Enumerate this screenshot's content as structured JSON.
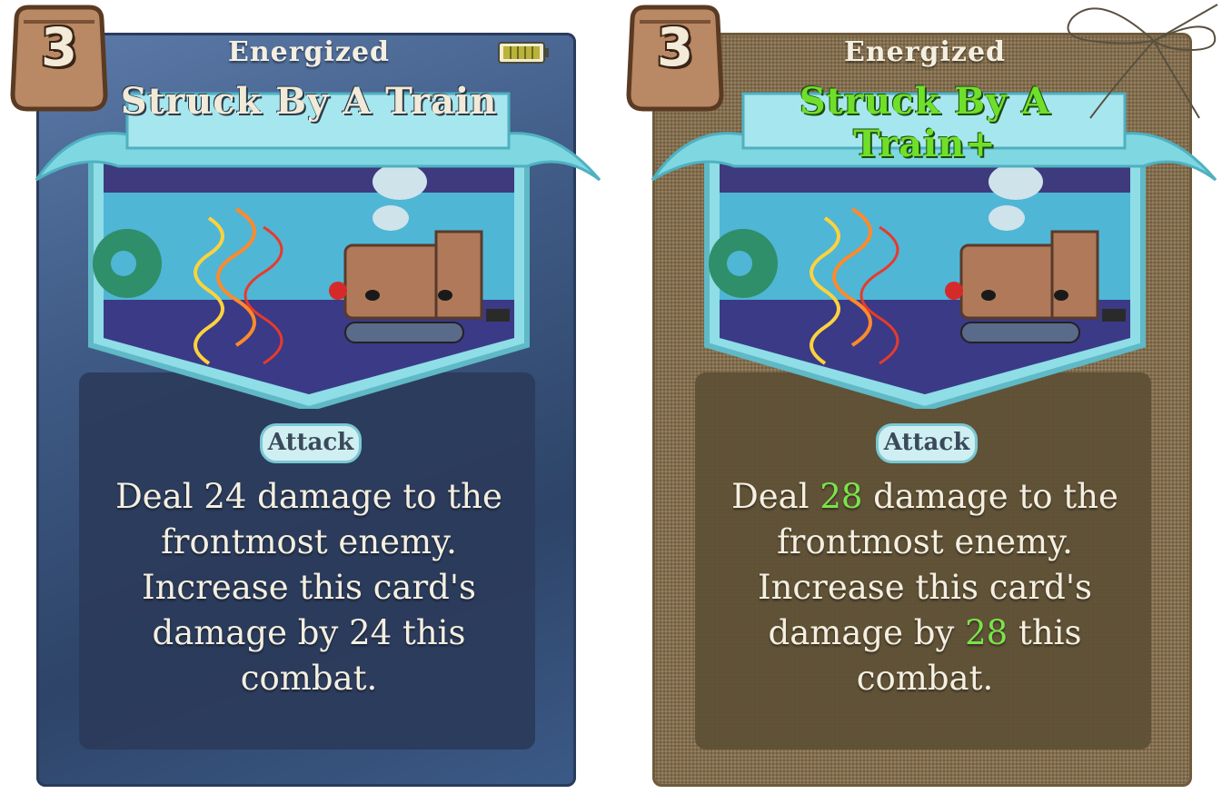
{
  "cards": [
    {
      "cost": "3",
      "keyword": "Energized",
      "title": "Struck By A Train",
      "type": "Attack",
      "description": {
        "line1_pre": "Deal ",
        "line1_value": "24",
        "line1_post": " damage to the",
        "line2": "frontmost enemy.",
        "line3": "Increase this card's",
        "line4_pre": "damage by ",
        "line4_value": "24",
        "line4_post": " this",
        "line5": "combat."
      },
      "charge_fraction": 1.0,
      "upgraded": false,
      "background": "blue",
      "title_color": "#f1ead8"
    },
    {
      "cost": "3",
      "keyword": "Energized",
      "title": "Struck By A Train+",
      "type": "Attack",
      "description": {
        "line1_pre": "Deal ",
        "line1_value": "28",
        "line1_post": " damage to the",
        "line2": "frontmost enemy.",
        "line3": "Increase this card's",
        "line4_pre": "damage by ",
        "line4_value": "28",
        "line4_post": " this",
        "line5": "combat."
      },
      "upgraded": true,
      "background": "burlap",
      "title_color": "#6fe02a",
      "highlight_color": "#7be34a"
    }
  ]
}
